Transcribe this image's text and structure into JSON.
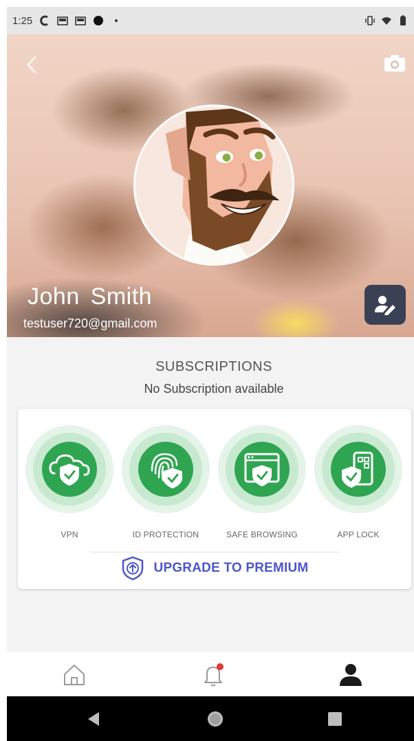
{
  "status_bar": {
    "time": "1:25",
    "icons": [
      "c-logo-icon",
      "mail-icon",
      "mail-icon",
      "record-dot-icon",
      "small-dot-icon",
      "vibrate-icon",
      "wifi-icon",
      "battery-icon"
    ]
  },
  "profile": {
    "name": "John  Smith",
    "email": "testuser720@gmail.com"
  },
  "subscriptions": {
    "title": "SUBSCRIPTIONS",
    "status": "No Subscription available"
  },
  "features": [
    {
      "label": "VPN",
      "icon": "cloud-shield-icon"
    },
    {
      "label": "ID PROTECTION",
      "icon": "fingerprint-shield-icon"
    },
    {
      "label": "SAFE BROWSING",
      "icon": "browser-shield-icon"
    },
    {
      "label": "APP LOCK",
      "icon": "phone-shield-icon"
    }
  ],
  "upgrade": {
    "label": "UPGRADE TO PREMIUM"
  },
  "bottom_nav": {
    "items": [
      "home-icon",
      "notification-bell-icon",
      "profile-icon"
    ]
  },
  "colors": {
    "accent": "#4b56c9",
    "feature_green": "#2fa552",
    "ring_light": "#e4f4e8",
    "ring_mid": "#c7e9cf",
    "edit_button": "#3a4155",
    "notification_dot": "#e53935"
  }
}
